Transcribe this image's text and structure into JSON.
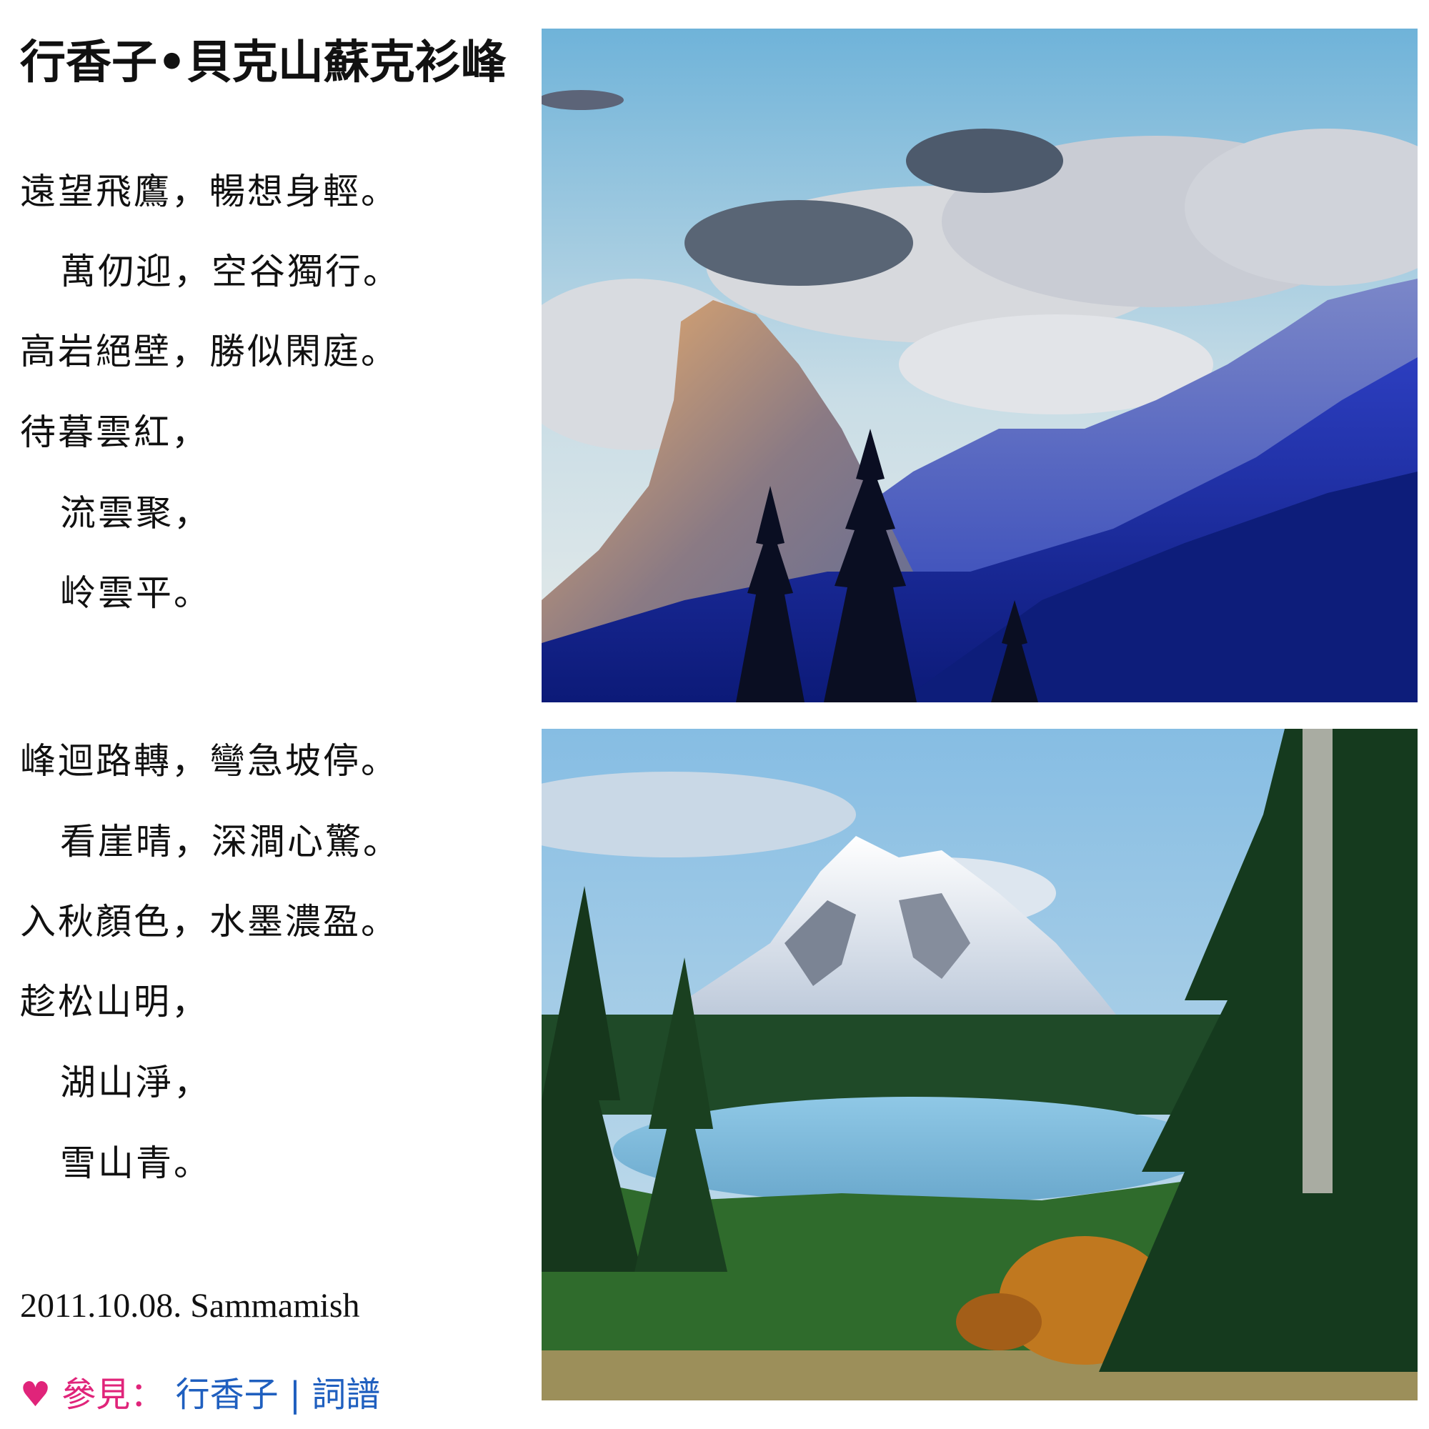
{
  "title": "行香子•貝克山蘇克衫峰",
  "stanza1": [
    "遠望飛鷹，暢想身輕。",
    "萬仞迎，空谷獨行。",
    "高岩絕壁，勝似閑庭。",
    "待暮雲紅，",
    "流雲聚，",
    "岭雲平。"
  ],
  "stanza2": [
    "峰迴路轉，彎急坡停。",
    "看崖晴，深澗心驚。",
    "入秋顏色，水墨濃盈。",
    "趁松山明，",
    "湖山淨，",
    "雪山青。"
  ],
  "footer": {
    "date": "2011.10.08. Sammamish",
    "heart": "♥",
    "see_label": "參見：",
    "link1": "行香子",
    "separator": "|",
    "link2": "詞譜"
  }
}
